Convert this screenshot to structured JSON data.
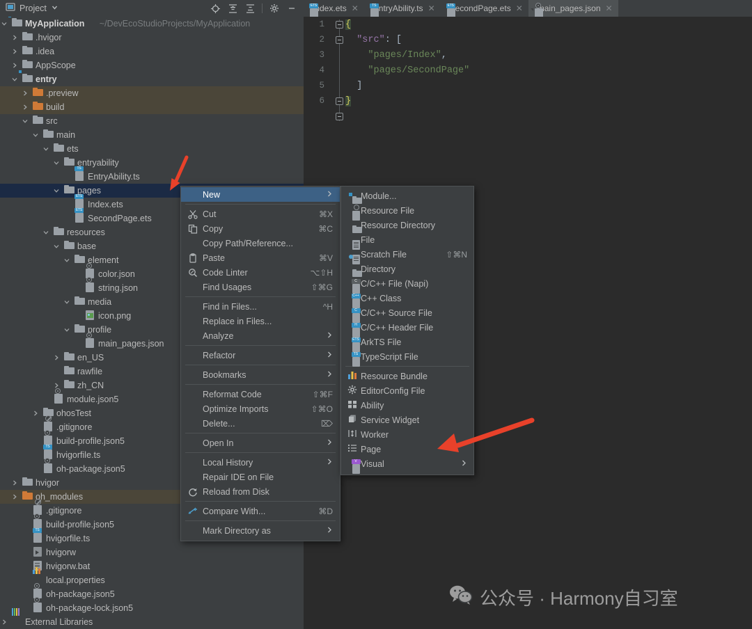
{
  "panel": {
    "title": "Project",
    "dropdown_icon": "chevron-down-icon",
    "toolbar": [
      "locate-icon",
      "expand-all-icon",
      "collapse-all-icon",
      "settings-gear-icon",
      "minimize-icon"
    ]
  },
  "tree": [
    {
      "label": "MyApplication",
      "path": "~/DevEcoStudioProjects/MyApplication",
      "indent": 0,
      "arrow": "v",
      "icon": "module-folder",
      "bold": true,
      "hl": ""
    },
    {
      "label": ".hvigor",
      "indent": 1,
      "arrow": ">",
      "icon": "folder-grey",
      "hl": ""
    },
    {
      "label": ".idea",
      "indent": 1,
      "arrow": ">",
      "icon": "folder-grey",
      "hl": ""
    },
    {
      "label": "AppScope",
      "indent": 1,
      "arrow": ">",
      "icon": "folder-grey",
      "hl": ""
    },
    {
      "label": "entry",
      "indent": 1,
      "arrow": "v",
      "icon": "module-folder",
      "bold": true,
      "hl": ""
    },
    {
      "label": ".preview",
      "indent": 2,
      "arrow": ">",
      "icon": "folder-orange",
      "hl": "brown"
    },
    {
      "label": "build",
      "indent": 2,
      "arrow": ">",
      "icon": "folder-orange",
      "hl": "brown"
    },
    {
      "label": "src",
      "indent": 2,
      "arrow": "v",
      "icon": "folder-grey",
      "hl": ""
    },
    {
      "label": "main",
      "indent": 3,
      "arrow": "v",
      "icon": "folder-grey",
      "hl": ""
    },
    {
      "label": "ets",
      "indent": 4,
      "arrow": "v",
      "icon": "folder-grey",
      "hl": ""
    },
    {
      "label": "entryability",
      "indent": 5,
      "arrow": "v",
      "icon": "folder-grey",
      "hl": ""
    },
    {
      "label": "EntryAbility.ts",
      "indent": 6,
      "arrow": "",
      "icon": "file-ts",
      "hl": ""
    },
    {
      "label": "pages",
      "indent": 5,
      "arrow": "v",
      "icon": "folder-grey",
      "hl": "blue"
    },
    {
      "label": "Index.ets",
      "indent": 6,
      "arrow": "",
      "icon": "file-ets",
      "hl": ""
    },
    {
      "label": "SecondPage.ets",
      "indent": 6,
      "arrow": "",
      "icon": "file-ets",
      "hl": ""
    },
    {
      "label": "resources",
      "indent": 4,
      "arrow": "v",
      "icon": "folder-grey",
      "hl": ""
    },
    {
      "label": "base",
      "indent": 5,
      "arrow": "v",
      "icon": "folder-grey",
      "hl": ""
    },
    {
      "label": "element",
      "indent": 6,
      "arrow": "v",
      "icon": "folder-grey",
      "hl": ""
    },
    {
      "label": "color.json",
      "indent": 7,
      "arrow": "",
      "icon": "file-json",
      "hl": ""
    },
    {
      "label": "string.json",
      "indent": 7,
      "arrow": "",
      "icon": "file-json",
      "hl": ""
    },
    {
      "label": "media",
      "indent": 6,
      "arrow": "v",
      "icon": "folder-grey",
      "hl": ""
    },
    {
      "label": "icon.png",
      "indent": 7,
      "arrow": "",
      "icon": "file-image",
      "hl": ""
    },
    {
      "label": "profile",
      "indent": 6,
      "arrow": "v",
      "icon": "folder-grey",
      "hl": ""
    },
    {
      "label": "main_pages.json",
      "indent": 7,
      "arrow": "",
      "icon": "file-json",
      "hl": ""
    },
    {
      "label": "en_US",
      "indent": 5,
      "arrow": ">",
      "icon": "folder-grey",
      "hl": ""
    },
    {
      "label": "rawfile",
      "indent": 5,
      "arrow": "",
      "icon": "folder-grey",
      "hl": ""
    },
    {
      "label": "zh_CN",
      "indent": 5,
      "arrow": ">",
      "icon": "folder-grey",
      "hl": ""
    },
    {
      "label": "module.json5",
      "indent": 4,
      "arrow": "",
      "icon": "file-json",
      "hl": ""
    },
    {
      "label": "ohosTest",
      "indent": 3,
      "arrow": ">",
      "icon": "folder-grey",
      "hl": ""
    },
    {
      "label": ".gitignore",
      "indent": 3,
      "arrow": "",
      "icon": "file-git",
      "hl": ""
    },
    {
      "label": "build-profile.json5",
      "indent": 3,
      "arrow": "",
      "icon": "file-json",
      "hl": ""
    },
    {
      "label": "hvigorfile.ts",
      "indent": 3,
      "arrow": "",
      "icon": "file-ts",
      "hl": ""
    },
    {
      "label": "oh-package.json5",
      "indent": 3,
      "arrow": "",
      "icon": "file-json",
      "hl": ""
    },
    {
      "label": "hvigor",
      "indent": 1,
      "arrow": ">",
      "icon": "folder-grey",
      "hl": ""
    },
    {
      "label": "oh_modules",
      "indent": 1,
      "arrow": ">",
      "icon": "folder-orange",
      "hl": "brown"
    },
    {
      "label": ".gitignore",
      "indent": 2,
      "arrow": "",
      "icon": "file-git",
      "hl": ""
    },
    {
      "label": "build-profile.json5",
      "indent": 2,
      "arrow": "",
      "icon": "file-json",
      "hl": ""
    },
    {
      "label": "hvigorfile.ts",
      "indent": 2,
      "arrow": "",
      "icon": "file-ts",
      "hl": ""
    },
    {
      "label": "hvigorw",
      "indent": 2,
      "arrow": "",
      "icon": "file-exe",
      "hl": ""
    },
    {
      "label": "hvigorw.bat",
      "indent": 2,
      "arrow": "",
      "icon": "file-text",
      "hl": ""
    },
    {
      "label": "local.properties",
      "indent": 2,
      "arrow": "",
      "icon": "file-properties",
      "hl": ""
    },
    {
      "label": "oh-package.json5",
      "indent": 2,
      "arrow": "",
      "icon": "file-json",
      "hl": ""
    },
    {
      "label": "oh-package-lock.json5",
      "indent": 2,
      "arrow": "",
      "icon": "file-json",
      "hl": ""
    },
    {
      "label": "External Libraries",
      "indent": 0,
      "arrow": ">",
      "icon": "libraries",
      "hl": ""
    }
  ],
  "editor": {
    "tabs": [
      {
        "label": "Index.ets",
        "icon": "file-ets",
        "active": false,
        "closable": true
      },
      {
        "label": "EntryAbility.ts",
        "icon": "file-ts",
        "active": false,
        "closable": true
      },
      {
        "label": "SecondPage.ets",
        "icon": "file-ets",
        "active": false,
        "closable": true
      },
      {
        "label": "main_pages.json",
        "icon": "file-json",
        "active": true,
        "closable": true
      }
    ],
    "line_numbers": [
      "1",
      "2",
      "3",
      "4",
      "5",
      "6"
    ],
    "code": [
      {
        "n": "1",
        "segments": [
          {
            "t": "{",
            "c": "brace"
          }
        ]
      },
      {
        "n": "2",
        "segments": [
          {
            "t": "  ",
            "c": "punc"
          },
          {
            "t": "\"src\"",
            "c": "key"
          },
          {
            "t": ": [",
            "c": "punc"
          }
        ]
      },
      {
        "n": "3",
        "segments": [
          {
            "t": "    ",
            "c": "punc"
          },
          {
            "t": "\"pages/Index\"",
            "c": "str"
          },
          {
            "t": ",",
            "c": "punc"
          }
        ]
      },
      {
        "n": "4",
        "segments": [
          {
            "t": "    ",
            "c": "punc"
          },
          {
            "t": "\"pages/SecondPage\"",
            "c": "str"
          }
        ]
      },
      {
        "n": "5",
        "segments": [
          {
            "t": "  ]",
            "c": "punc"
          }
        ]
      },
      {
        "n": "6",
        "segments": [
          {
            "t": "}",
            "c": "brace"
          }
        ]
      }
    ]
  },
  "context_menu": {
    "items": [
      {
        "label": "New",
        "icon": "",
        "accel": "",
        "chevron": true,
        "selected": true
      },
      {
        "sep": true
      },
      {
        "label": "Cut",
        "icon": "scissors-icon",
        "accel": "⌘X"
      },
      {
        "label": "Copy",
        "icon": "copy-icon",
        "accel": "⌘C"
      },
      {
        "label": "Copy Path/Reference...",
        "icon": "",
        "accel": ""
      },
      {
        "label": "Paste",
        "icon": "clipboard-icon",
        "accel": "⌘V"
      },
      {
        "label": "Code Linter",
        "icon": "magnifier-icon",
        "accel": "⌥⇧H"
      },
      {
        "label": "Find Usages",
        "icon": "",
        "accel": "⇧⌘G"
      },
      {
        "sep": true
      },
      {
        "label": "Find in Files...",
        "icon": "",
        "accel": "^H"
      },
      {
        "label": "Replace in Files...",
        "icon": "",
        "accel": ""
      },
      {
        "label": "Analyze",
        "icon": "",
        "accel": "",
        "chevron": true
      },
      {
        "sep": true
      },
      {
        "label": "Refactor",
        "icon": "",
        "accel": "",
        "chevron": true
      },
      {
        "sep": true
      },
      {
        "label": "Bookmarks",
        "icon": "",
        "accel": "",
        "chevron": true
      },
      {
        "sep": true
      },
      {
        "label": "Reformat Code",
        "icon": "",
        "accel": "⇧⌘F"
      },
      {
        "label": "Optimize Imports",
        "icon": "",
        "accel": "⇧⌘O"
      },
      {
        "label": "Delete...",
        "icon": "",
        "accel": "⌦"
      },
      {
        "sep": true
      },
      {
        "label": "Open In",
        "icon": "",
        "accel": "",
        "chevron": true
      },
      {
        "sep": true
      },
      {
        "label": "Local History",
        "icon": "",
        "accel": "",
        "chevron": true
      },
      {
        "label": "Repair IDE on File",
        "icon": "",
        "accel": ""
      },
      {
        "label": "Reload from Disk",
        "icon": "reload-icon",
        "accel": ""
      },
      {
        "sep": true
      },
      {
        "label": "Compare With...",
        "icon": "compare-icon",
        "accel": "⌘D"
      },
      {
        "sep": true
      },
      {
        "label": "Mark Directory as",
        "icon": "",
        "accel": "",
        "chevron": true
      }
    ]
  },
  "sub_menu": {
    "items": [
      {
        "label": "Module...",
        "icon": "module-folder-icon",
        "accel": ""
      },
      {
        "label": "Resource File",
        "icon": "resource-file-icon",
        "accel": ""
      },
      {
        "label": "Resource Directory",
        "icon": "folder-icon",
        "accel": ""
      },
      {
        "label": "File",
        "icon": "file-icon",
        "accel": ""
      },
      {
        "label": "Scratch File",
        "icon": "scratch-file-icon",
        "accel": "⇧⌘N"
      },
      {
        "label": "Directory",
        "icon": "folder-icon",
        "accel": ""
      },
      {
        "label": "C/C++ File (Napi)",
        "icon": "c-file-icon",
        "accel": ""
      },
      {
        "label": "C++ Class",
        "icon": "cpp-class-icon",
        "accel": ""
      },
      {
        "label": "C/C++ Source File",
        "icon": "c-source-icon",
        "accel": ""
      },
      {
        "label": "C/C++ Header File",
        "icon": "h-header-icon",
        "accel": ""
      },
      {
        "label": "ArkTS File",
        "icon": "ets-file-icon",
        "accel": ""
      },
      {
        "label": "TypeScript File",
        "icon": "ts-file-icon",
        "accel": ""
      },
      {
        "sep": true
      },
      {
        "label": "Resource Bundle",
        "icon": "resource-bundle-icon",
        "accel": ""
      },
      {
        "label": "EditorConfig File",
        "icon": "gear-icon",
        "accel": ""
      },
      {
        "label": "Ability",
        "icon": "ability-icon",
        "accel": ""
      },
      {
        "label": "Service Widget",
        "icon": "widget-icon",
        "accel": ""
      },
      {
        "label": "Worker",
        "icon": "worker-icon",
        "accel": ""
      },
      {
        "label": "Page",
        "icon": "page-list-icon",
        "accel": ""
      },
      {
        "label": "Visual",
        "icon": "visual-icon",
        "accel": "",
        "chevron": true
      }
    ]
  },
  "watermark": {
    "icon": "wechat-icon",
    "text": "公众号 · Harmony自习室"
  },
  "colors": {
    "panel_bg": "#3c3f41",
    "editor_bg": "#2b2b2b",
    "selection_blue": "#3d6185",
    "highlight_brown": "#4b4639",
    "row_selected_blue": "#1b2a44",
    "arrow_red": "#e8412a",
    "accent_blue": "#3592c4"
  }
}
